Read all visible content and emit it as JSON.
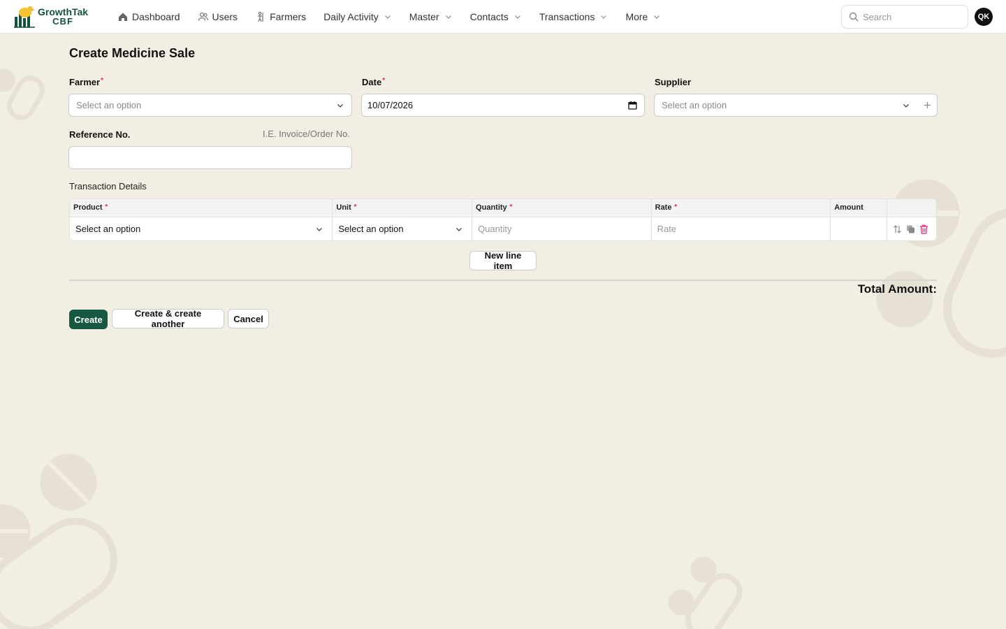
{
  "brand": {
    "name": "GrowthTak",
    "sub": "CBF"
  },
  "nav": [
    {
      "label": "Dashboard",
      "icon": "home-icon",
      "dropdown": false
    },
    {
      "label": "Users",
      "icon": "users-icon",
      "dropdown": false
    },
    {
      "label": "Farmers",
      "icon": "farmer-icon",
      "dropdown": false
    },
    {
      "label": "Daily Activity",
      "dropdown": true
    },
    {
      "label": "Master",
      "dropdown": true
    },
    {
      "label": "Contacts",
      "dropdown": true
    },
    {
      "label": "Transactions",
      "dropdown": true
    },
    {
      "label": "More",
      "dropdown": true
    }
  ],
  "search": {
    "placeholder": "Search"
  },
  "user": {
    "initials": "QK"
  },
  "page": {
    "title": "Create Medicine Sale"
  },
  "form": {
    "farmer": {
      "label": "Farmer",
      "placeholder": "Select an option"
    },
    "date": {
      "label": "Date",
      "value": "10/07/2026"
    },
    "supplier": {
      "label": "Supplier",
      "placeholder": "Select an option"
    },
    "reference": {
      "label": "Reference No.",
      "hint": "I.E. Invoice/Order No.",
      "value": ""
    }
  },
  "transactions": {
    "label": "Transaction Details",
    "columns": [
      {
        "label": "Product",
        "required": true
      },
      {
        "label": "Unit",
        "required": true
      },
      {
        "label": "Quantity",
        "required": true
      },
      {
        "label": "Rate",
        "required": true
      },
      {
        "label": "Amount",
        "required": false
      }
    ],
    "row": {
      "product": "Select an option",
      "unit": "Select an option",
      "quantity_placeholder": "Quantity",
      "rate_placeholder": "Rate",
      "amount": ""
    },
    "new_line_label": "New line item"
  },
  "total": {
    "label": "Total Amount:"
  },
  "actions": {
    "create": "Create",
    "create_another": "Create & create another",
    "cancel": "Cancel"
  },
  "colors": {
    "primary": "#175842",
    "background": "#f3eee3",
    "required": "#e0245e",
    "danger": "#e4418e"
  }
}
